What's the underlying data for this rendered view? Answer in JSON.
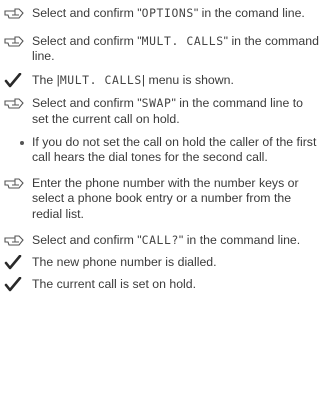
{
  "steps": [
    {
      "type": "action",
      "icon": "hand-pointing-icon",
      "parts": [
        "Select and confirm \"",
        "OPTIONS",
        "\" in the comand line."
      ]
    },
    {
      "type": "action",
      "icon": "hand-pointing-icon",
      "parts": [
        "Select and confirm \"",
        "MULT. CALLS",
        "\" in the command line."
      ]
    },
    {
      "type": "result",
      "icon": "checkmark-icon",
      "parts": [
        "The |",
        "MULT. CALLS",
        "| menu is shown."
      ]
    },
    {
      "type": "action",
      "icon": "hand-pointing-icon",
      "parts": [
        "Select and confirm \"",
        "SWAP",
        "\" in the command line to set the current call on hold."
      ]
    },
    {
      "type": "note",
      "icon": "bullet-dot",
      "text": "If you do not set the call on hold the caller of the first call hears the dial tones for the second call."
    },
    {
      "type": "action",
      "icon": "hand-pointing-icon",
      "text": "Enter the phone number with the number keys or select a phone book entry or a number from the redial list."
    },
    {
      "type": "action",
      "icon": "hand-pointing-icon",
      "parts": [
        "Select and confirm \"",
        "CALL?",
        "\" in the command line."
      ]
    },
    {
      "type": "result",
      "icon": "checkmark-icon",
      "text": "The new phone number is dialled."
    },
    {
      "type": "result",
      "icon": "checkmark-icon",
      "text": "The current call is set on hold."
    }
  ]
}
